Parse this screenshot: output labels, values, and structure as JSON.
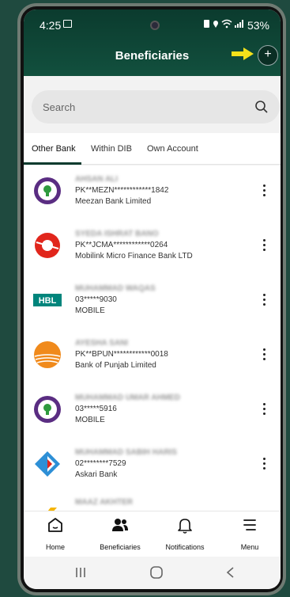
{
  "status_bar": {
    "time": "4:25",
    "battery": "53%"
  },
  "header": {
    "title": "Beneficiaries",
    "add_label": "+"
  },
  "search": {
    "placeholder": "Search"
  },
  "tabs": [
    {
      "label": "Other Bank",
      "active": true
    },
    {
      "label": "Within DIB",
      "active": false
    },
    {
      "label": "Own Account",
      "active": false
    }
  ],
  "beneficiaries": [
    {
      "name": "AHSAN ALI",
      "account": "PK**MEZN************1842",
      "bank": "Meezan Bank Limited",
      "logo": "meezan-bank-logo"
    },
    {
      "name": "SYEDA ISHRAT BANO",
      "account": "PK**JCMA************0264",
      "bank": "Mobilink Micro Finance Bank LTD",
      "logo": "mobilink-logo"
    },
    {
      "name": "MUHAMMAD WAQAS",
      "account": "03*****9030",
      "bank": "MOBILE",
      "logo": "hbl-logo",
      "logo_text": "HBL"
    },
    {
      "name": "AYESHA SANI",
      "account": "PK**BPUN************0018",
      "bank": "Bank of Punjab Limited",
      "logo": "bank-of-punjab-logo"
    },
    {
      "name": "MUHAMMAD UMAR AHMED",
      "account": "03*****5916",
      "bank": "MOBILE",
      "logo": "meezan-bank-logo"
    },
    {
      "name": "MUHAMMAD SABIH HARIS",
      "account": "02********7529",
      "bank": "Askari Bank",
      "logo": "askari-bank-logo"
    },
    {
      "name": "MAAZ AKHTER",
      "account": "",
      "bank": "",
      "logo": "partial-logo"
    }
  ],
  "bottom_nav": [
    {
      "label": "Home",
      "icon": "home-icon"
    },
    {
      "label": "Beneficiaries",
      "icon": "people-icon"
    },
    {
      "label": "Notifications",
      "icon": "bell-icon"
    },
    {
      "label": "Menu",
      "icon": "menu-icon"
    }
  ],
  "colors": {
    "primary": "#0b3b2e",
    "arrow": "#f5e11a",
    "meezan": "#5a2d82",
    "hbl": "#00857c",
    "mobilink": "#e1261c",
    "punjab": "#f08a1c",
    "askari": "#2d8fd6"
  }
}
